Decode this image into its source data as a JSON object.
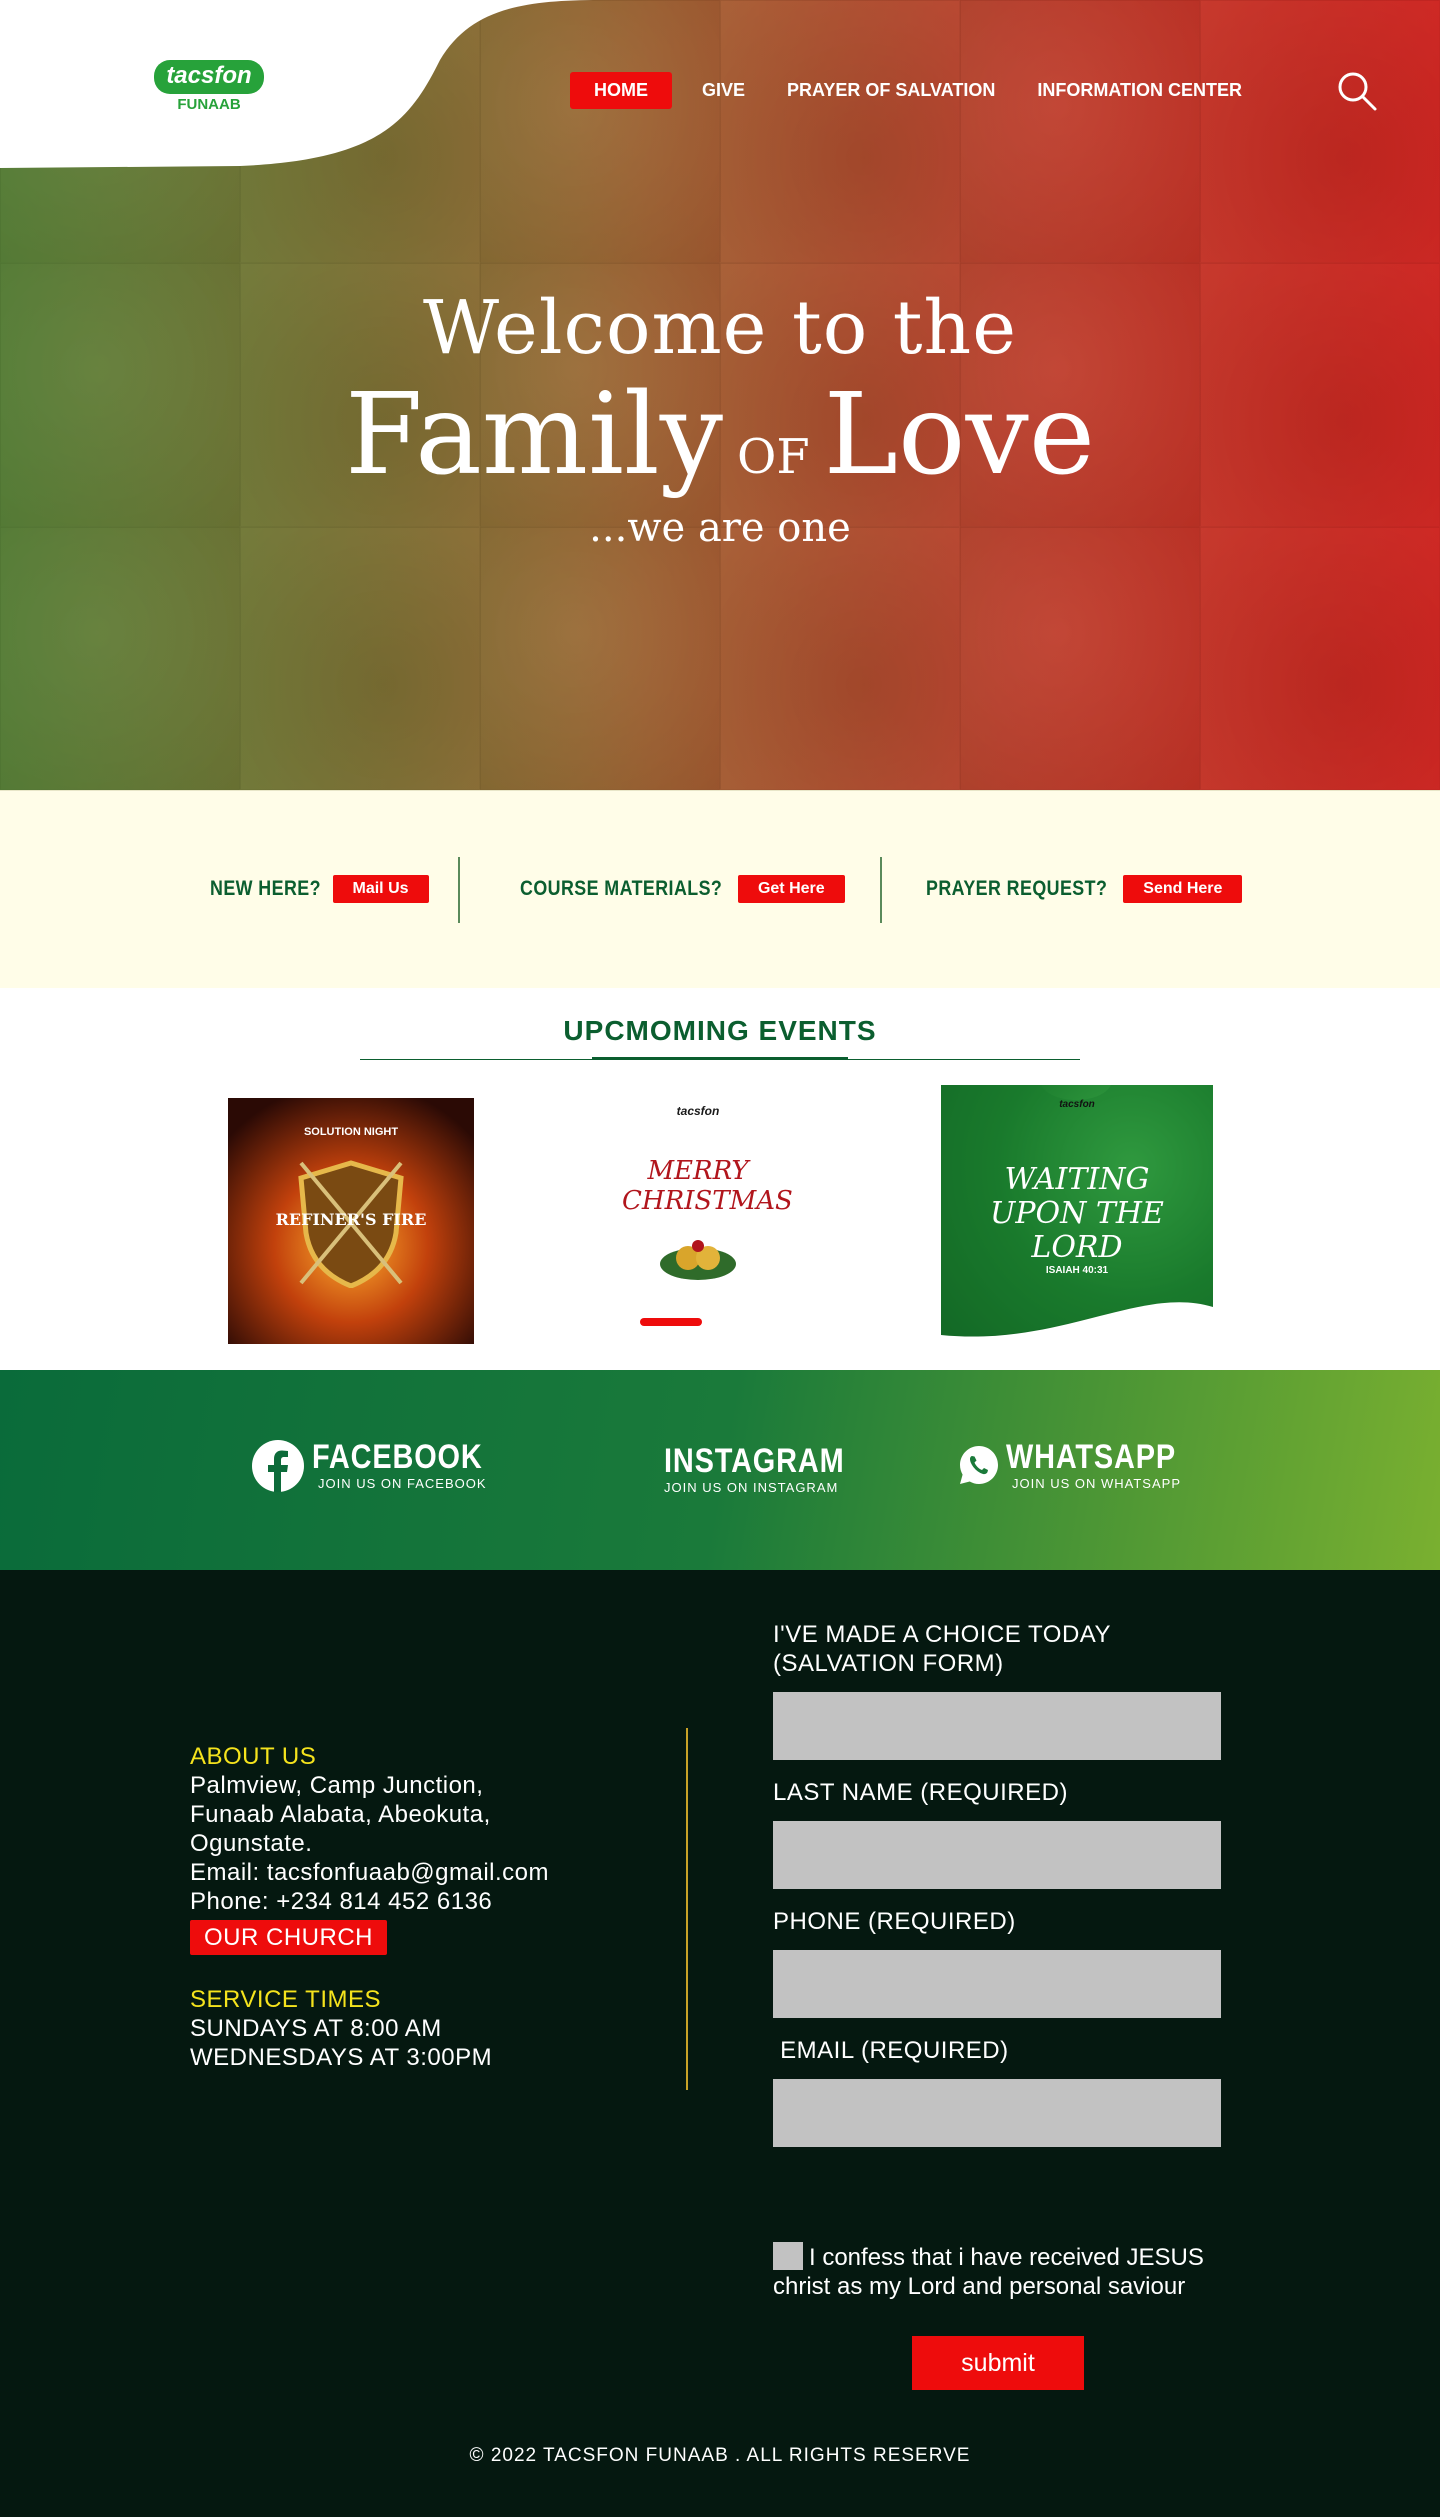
{
  "nav": {
    "items": [
      "HOME",
      "GIVE",
      "PRAYER OF SALVATION",
      "INFORMATION CENTER"
    ],
    "active": "HOME",
    "search_icon": "search-icon"
  },
  "logo": {
    "text": "tacsfon",
    "sub": "FUNAAB"
  },
  "hero": {
    "line1": "Welcome to the",
    "line2a": "Family",
    "line2b": "OF",
    "line2c": "Love",
    "line3": "...we are one"
  },
  "quick_links": [
    {
      "label": "NEW HERE?",
      "button": "Mail Us"
    },
    {
      "label": "COURSE MATERIALS?",
      "button": "Get Here"
    },
    {
      "label": "PRAYER REQUEST?",
      "button": "Send Here"
    }
  ],
  "events": {
    "title": "UPCMOMING EVENTS",
    "posters": [
      {
        "top": "SOLUTION NIGHT",
        "main": "REFINER'S FIRE"
      },
      {
        "top": "tacsfon",
        "main": "MERRY CHRISTMAS"
      },
      {
        "top": "tacsfon",
        "main": "WAITING UPON THE LORD",
        "sub": "ISAIAH 40:31"
      }
    ]
  },
  "social": [
    {
      "name": "FACEBOOK",
      "sub": "JOIN US ON FACEBOOK",
      "icon": "facebook-icon"
    },
    {
      "name": "INSTAGRAM",
      "sub": "JOIN US ON INSTAGRAM"
    },
    {
      "name": "WHATSAPP",
      "sub": "JOIN US ON WHATSAPP",
      "icon": "whatsapp-icon"
    }
  ],
  "about": {
    "heading": "ABOUT US",
    "address1": "Palmview, Camp Junction,",
    "address2": "Funaab Alabata, Abeokuta,",
    "address3": "Ogunstate.",
    "email": "Email: tacsfonfuaab@gmail.com",
    "phone": "Phone: +234 814 452 6136",
    "church_button": "OUR CHURCH",
    "service_heading": "SERVICE TIMES",
    "service1": "SUNDAYS AT 8:00 AM",
    "service2": "WEDNESDAYS AT 3:00PM"
  },
  "form": {
    "title1": "I'VE MADE A CHOICE TODAY",
    "title2": "(SALVATION FORM)",
    "last_name": "LAST NAME (REQUIRED)",
    "phone": "PHONE (REQUIRED)",
    "email": " EMAIL (REQUIRED)",
    "confess1": "I confess that i have received JESUS",
    "confess2": "christ as my Lord and personal saviour",
    "submit": "submit"
  },
  "footer": {
    "copyright": "© 2022 TACSFON FUNAAB . ALL RIGHTS RESERVE"
  },
  "colors": {
    "red": "#ee0c0c",
    "green": "#0b5e2f",
    "footer_bg": "#051810",
    "gold": "#f5e31d"
  }
}
